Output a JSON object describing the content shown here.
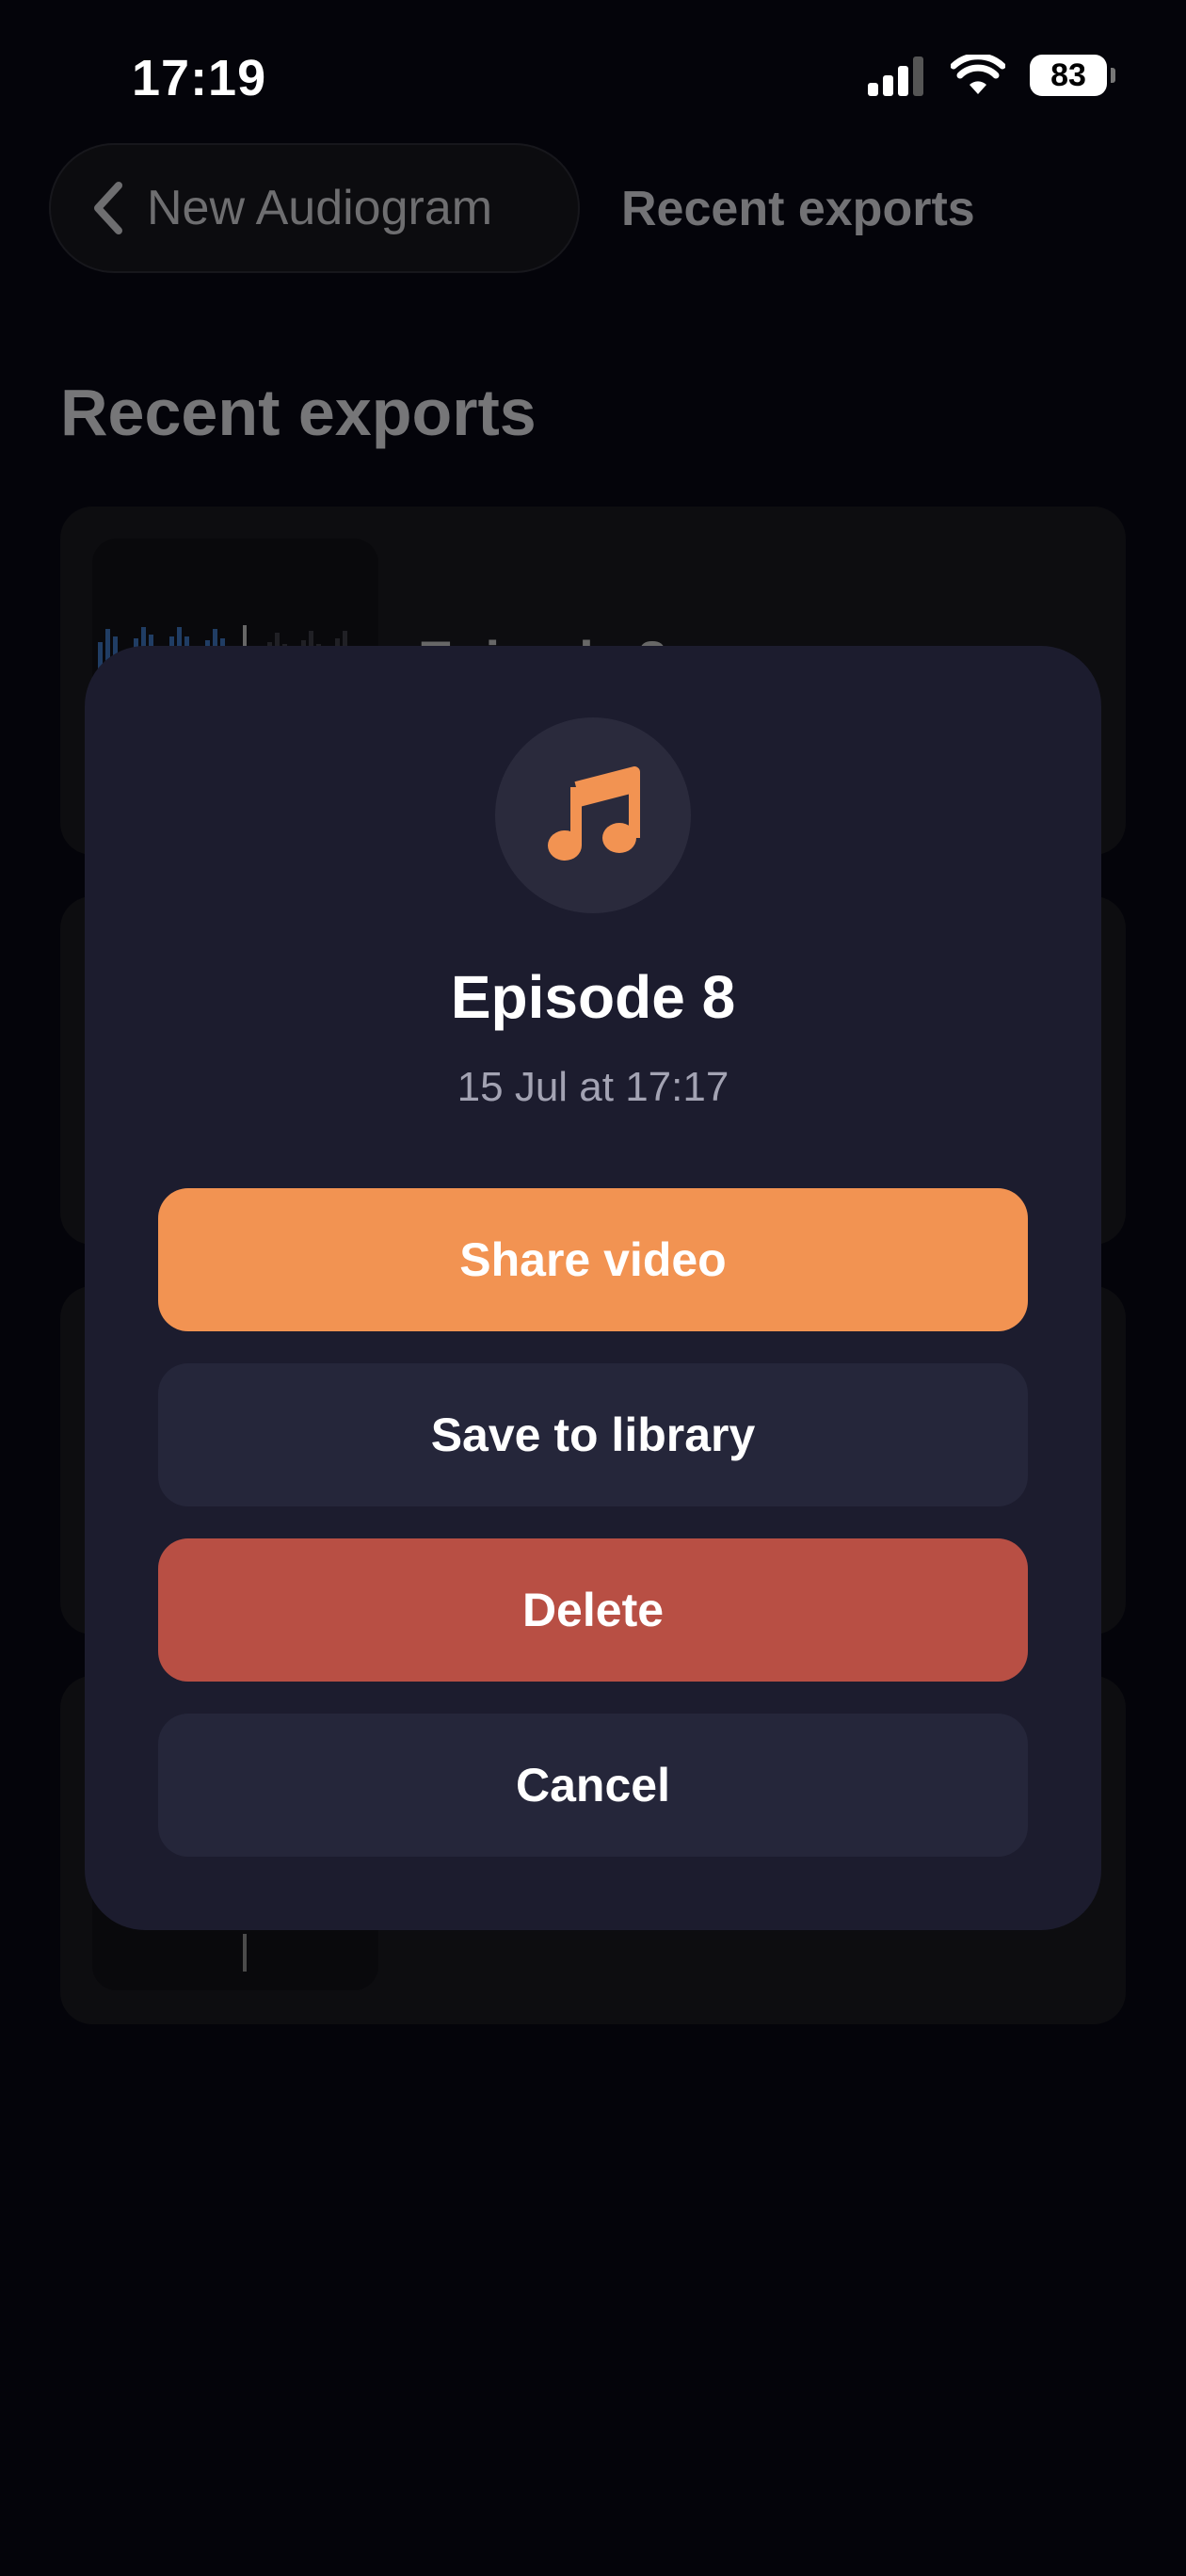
{
  "status_bar": {
    "time": "17:19",
    "battery": "83"
  },
  "nav": {
    "back_label": "New Audiogram",
    "title": "Recent exports"
  },
  "page": {
    "title": "Recent exports"
  },
  "exports": [
    {
      "title": "Episode 8"
    }
  ],
  "dialog": {
    "icon": "music-note-icon",
    "title": "Episode 8",
    "date": "15 Jul at 17:17",
    "share_label": "Share video",
    "save_label": "Save to library",
    "delete_label": "Delete",
    "cancel_label": "Cancel"
  },
  "colors": {
    "accent": "#f29352",
    "danger": "#b84f44",
    "modal": "#1c1c2e",
    "secondary_button": "#25263a"
  }
}
